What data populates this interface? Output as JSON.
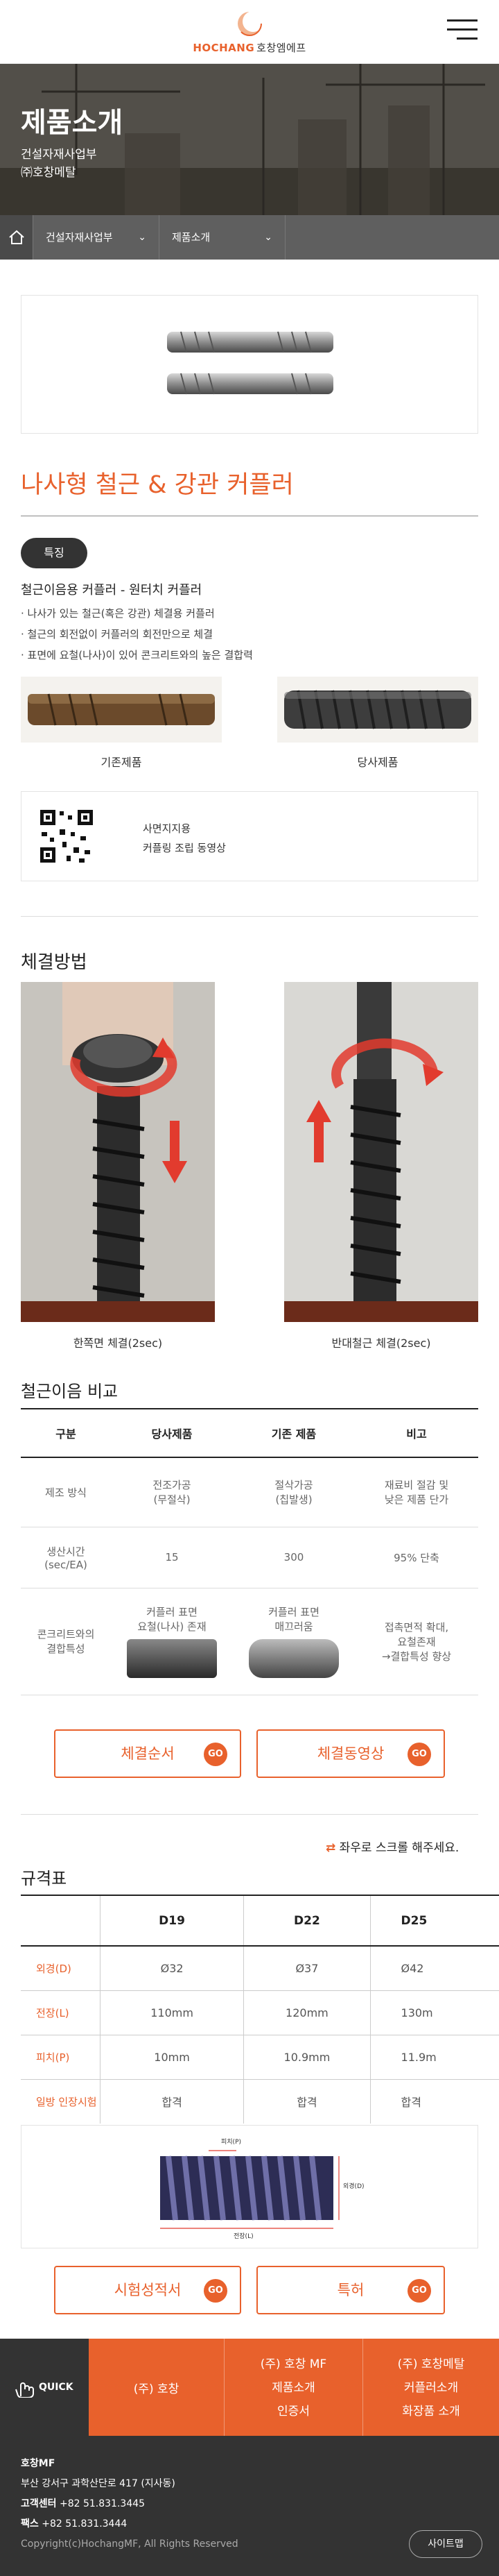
{
  "header": {
    "logo_text": "HOCHANG",
    "logo_sub": "호창엠에프",
    "menu_icon": "hamburger-icon"
  },
  "hero": {
    "title": "제품소개",
    "line1": "건설자재사업부",
    "line2": "㈜호창메탈"
  },
  "breadcrumb": {
    "home_icon": "home-icon",
    "sel1": "건설자재사업부",
    "sel2": "제품소개"
  },
  "product": {
    "title": "나사형 철근 & 강관 커플러",
    "badge": "특징",
    "heading": "철근이음용 커플러 - 원터치 커플러",
    "features": [
      "· 나사가 있는 철근(혹은 강관) 체결용 커플러",
      "· 철근의 회전없이 커플러의 회전만으로 체결",
      "· 표면에 요철(나사)이 있어 콘크리트와의 높은 결합력"
    ],
    "img_left_caption": "기존제품",
    "img_right_caption": "당사제품"
  },
  "qr": {
    "line1": "사면지지용",
    "line2": "커플링 조립 동영상"
  },
  "fastening": {
    "title": "체결방법",
    "left_caption": "한쪽면 체결(2sec)",
    "right_caption": "반대철근 체결(2sec)"
  },
  "compare": {
    "title": "철근이음 비교",
    "headers": [
      "구분",
      "당사제품",
      "기존 제품",
      "비고"
    ],
    "rows": [
      [
        "제조 방식",
        "전조가공\n(무절삭)",
        "절삭가공\n(칩발생)",
        "재료비 절감 및\n낮은 제품 단가"
      ],
      [
        "생산시간\n(sec/EA)",
        "15",
        "300",
        "95% 단축"
      ],
      [
        "콘크리트와의\n결합특성",
        "커플러 표면\n요철(나사) 존재",
        "커플러 표면\n매끄러움",
        "접촉면적 확대,\n요철존재\n→결합특성 향상"
      ]
    ]
  },
  "buttons": {
    "b1": "체결순서",
    "b2": "체결동영상",
    "b3": "시험성적서",
    "b4": "특허",
    "go": "GO"
  },
  "spec": {
    "scroll_hint": "좌우로 스크롤 해주세요.",
    "title": "규격표",
    "cols": [
      "D19",
      "D22",
      "D25"
    ],
    "rows": [
      {
        "label": "외경(D)",
        "values": [
          "Ø32",
          "Ø37",
          "Ø42"
        ]
      },
      {
        "label": "전장(L)",
        "values": [
          "110mm",
          "120mm",
          "130m"
        ]
      },
      {
        "label": "피치(P)",
        "values": [
          "10mm",
          "10.9mm",
          "11.9m"
        ]
      },
      {
        "label": "일방 인장시험",
        "values": [
          "합격",
          "합격",
          "합격"
        ]
      }
    ],
    "diagram": {
      "pitch": "피치(P)",
      "od": "외경(D)",
      "len": "전장(L)"
    }
  },
  "quick": {
    "label": "QUICK",
    "col1": "(주) 호창",
    "col2_title": "(주) 호창 MF",
    "col2_items": [
      "제품소개",
      "인증서"
    ],
    "col3_title": "(주) 호창메탈",
    "col3_items": [
      "커플러소개",
      "화장품 소개"
    ]
  },
  "footer": {
    "company": "호창MF",
    "address": "부산 강서구 과학산단로 417 (지사동)",
    "tel_label": "고객센터",
    "tel": "+82 51.831.3445",
    "fax_label": "팩스",
    "fax": "+82 51.831.3444",
    "copy": "Copyright(c)HochangMF, All Rights Reserved",
    "sitemap": "사이트맵"
  },
  "colors": {
    "accent": "#e8612c",
    "dark": "#333333"
  }
}
